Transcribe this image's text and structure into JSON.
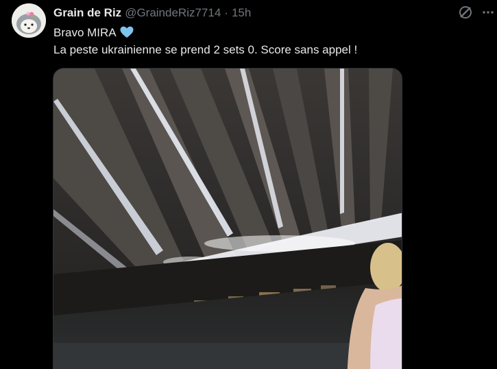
{
  "tweet": {
    "author": {
      "name": "Grain de Riz",
      "handle": "@GraindeRiz7714",
      "separator": "·",
      "time": "15h",
      "avatar_icon": "hedgehog-avatar-icon"
    },
    "text_line1": "Bravo MIRA",
    "emoji": "blue-heart-icon",
    "text_line2": "La peste ukrainienne se prend 2 sets 0. Score sans appel !",
    "media_type": "video-thumbnail",
    "icons": {
      "grok": "grok-icon",
      "more": "more-icon"
    },
    "colors": {
      "background": "#000000",
      "text": "#e7e9ea",
      "secondary": "#71767b",
      "heart": "#7dc4ef"
    }
  }
}
